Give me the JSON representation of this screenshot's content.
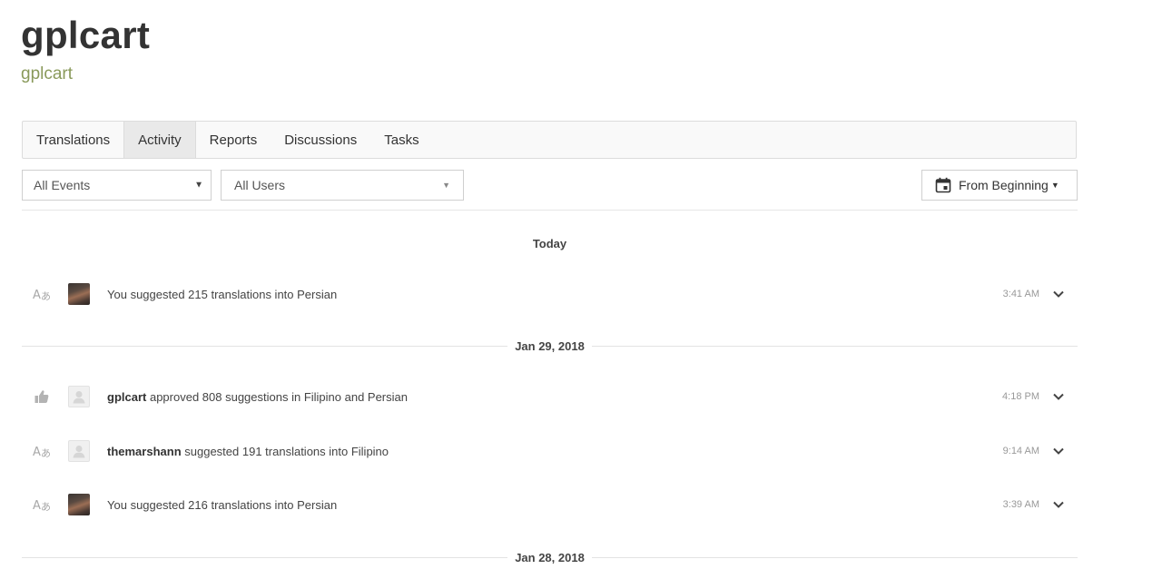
{
  "project": {
    "title": "gplcart",
    "subtitle": "gplcart"
  },
  "tabs": [
    {
      "label": "Translations",
      "active": false
    },
    {
      "label": "Activity",
      "active": true
    },
    {
      "label": "Reports",
      "active": false
    },
    {
      "label": "Discussions",
      "active": false
    },
    {
      "label": "Tasks",
      "active": false
    }
  ],
  "filters": {
    "events": "All Events",
    "users": "All Users",
    "date_range": "From Beginning"
  },
  "sections": [
    {
      "date": "Today",
      "items": [
        {
          "type_icon": "translate-icon",
          "avatar": "photo",
          "user": "You",
          "action": "suggested 215 translations into Persian",
          "time": "3:41 AM"
        }
      ]
    },
    {
      "date": "Jan 29, 2018",
      "items": [
        {
          "type_icon": "thumbs-up-icon",
          "avatar": "default",
          "user": "gplcart",
          "action": "approved 808 suggestions in Filipino and Persian",
          "time": "4:18 PM"
        },
        {
          "type_icon": "translate-icon",
          "avatar": "default",
          "user": "themarshann",
          "action": "suggested 191 translations into Filipino",
          "time": "9:14 AM"
        },
        {
          "type_icon": "translate-icon",
          "avatar": "photo",
          "user": "You",
          "action": "suggested 216 translations into Persian",
          "time": "3:39 AM"
        }
      ]
    },
    {
      "date": "Jan 28, 2018",
      "items": []
    }
  ],
  "colors": {
    "subtitle": "#8a9a5b",
    "tab_active_bg": "#e9e9e9",
    "muted_text": "#999999"
  }
}
